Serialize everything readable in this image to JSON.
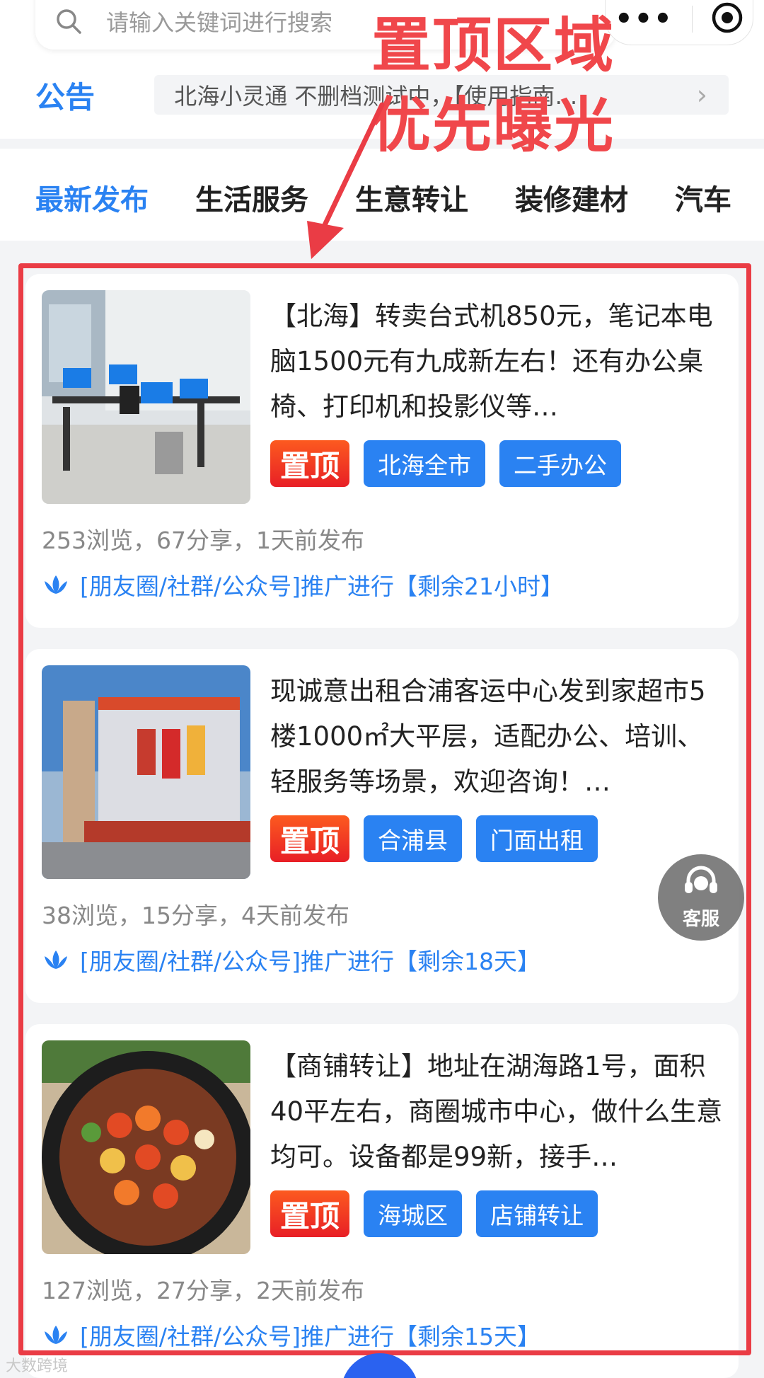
{
  "search": {
    "placeholder": "请输入关键词进行搜索"
  },
  "capsule": {
    "more_label": "•••"
  },
  "notice": {
    "label": "公告",
    "text": "北海小灵通 不删档测试中，【使用指南…"
  },
  "tabs": [
    {
      "label": "最新发布",
      "active": true
    },
    {
      "label": "生活服务"
    },
    {
      "label": "生意转让"
    },
    {
      "label": "装修建材"
    },
    {
      "label": "汽车"
    }
  ],
  "annotation": {
    "title": "置顶区域",
    "subtitle": "优先曝光"
  },
  "listings": [
    {
      "title": "【北海】转卖台式机850元，笔记本电脑1500元有九成新左右！还有办公桌椅、打印机和投影仪等…",
      "top_tag": "置顶",
      "tags": [
        "北海全市",
        "二手办公"
      ],
      "stats": "253浏览，67分享，1天前发布",
      "promo": "[朋友圈/社群/公众号]推广进行【剩余21小时】"
    },
    {
      "title": "现诚意出租合浦客运中心发到家超市5楼1000㎡大平层，适配办公、培训、轻服务等场景，欢迎咨询！…",
      "top_tag": "置顶",
      "tags": [
        "合浦县",
        "门面出租"
      ],
      "stats": "38浏览，15分享，4天前发布",
      "promo": "[朋友圈/社群/公众号]推广进行【剩余18天】"
    },
    {
      "title": "【商铺转让】地址在湖海路1号，面积40平左右，商圈城市中心，做什么生意均可。设备都是99新，接手…",
      "top_tag": "置顶",
      "tags": [
        "海城区",
        "店铺转让"
      ],
      "stats": "127浏览，27分享，2天前发布",
      "promo": "[朋友圈/社群/公众号]推广进行【剩余15天】"
    }
  ],
  "customer_service": {
    "label": "客服"
  },
  "watermark": "大数跨境",
  "colors": {
    "accent": "#2a82f2",
    "annotation_red": "#ea3c45",
    "top_tag_red": "#e81f26"
  }
}
